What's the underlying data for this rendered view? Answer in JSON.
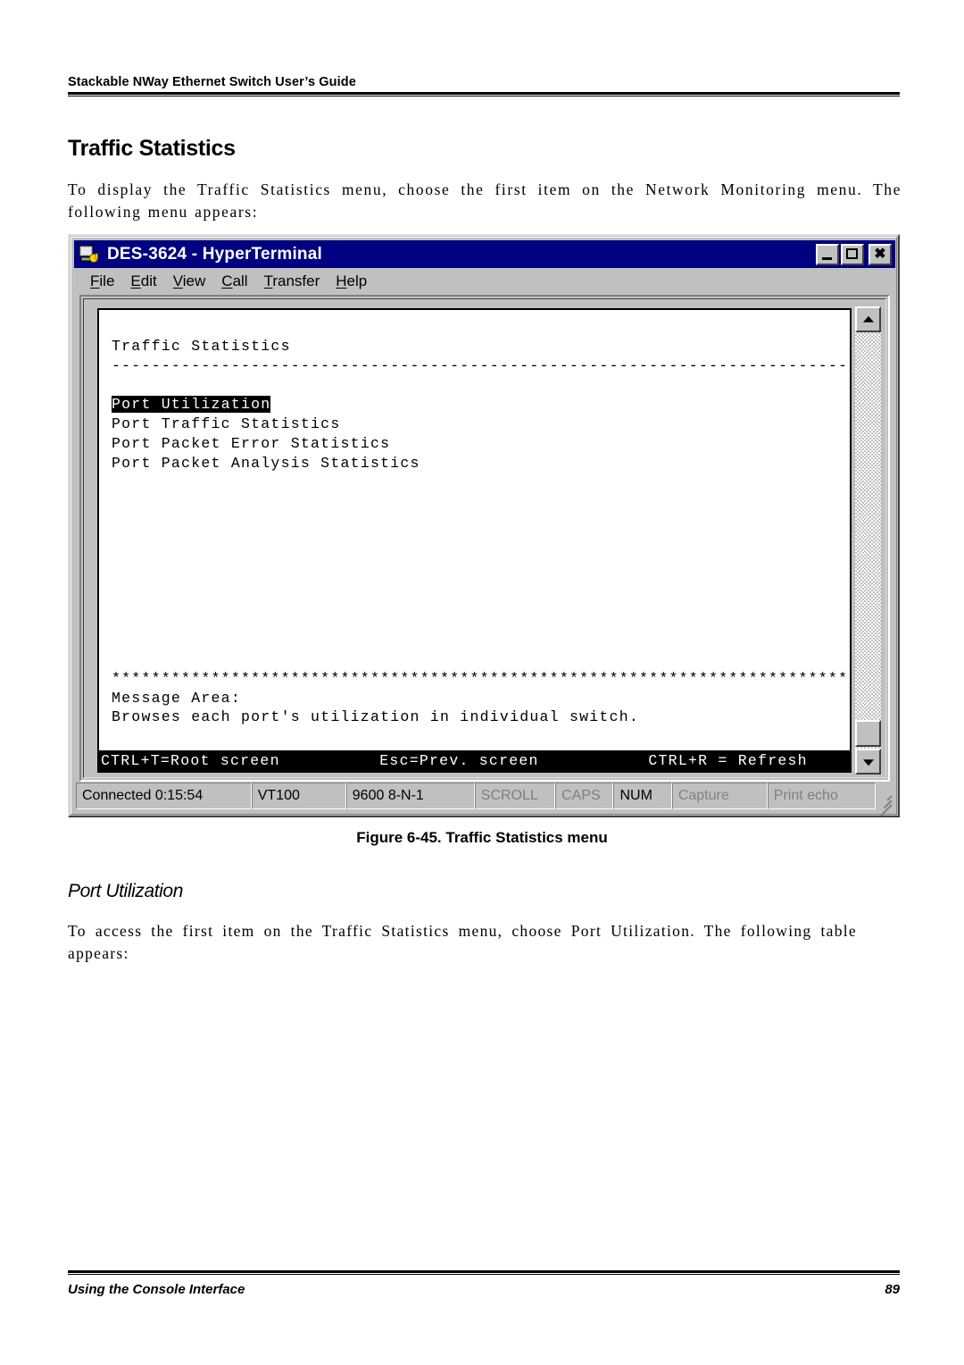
{
  "page": {
    "running_head": "Stackable NWay Ethernet Switch User’s Guide",
    "heading": "Traffic Statistics",
    "intro_paragraph": "To display the Traffic Statistics menu, choose the first item on the Network Monitoring menu. The following menu appears:",
    "figure_caption": "Figure 6-45.  Traffic Statistics menu",
    "subheading": "Port Utilization",
    "access_paragraph": "To access the first item on the Traffic Statistics menu, choose Port Utilization. The following table appears:",
    "footer_left": "Using the Console Interface",
    "footer_page": "89"
  },
  "hyperterminal": {
    "title": "DES-3624 - HyperTerminal",
    "icon": "hyperterminal-icon",
    "window_buttons": {
      "minimize": "–",
      "maximize": "□",
      "close": "✕"
    },
    "menu": [
      {
        "label": "File",
        "accel": "F"
      },
      {
        "label": "Edit",
        "accel": "E"
      },
      {
        "label": "View",
        "accel": "V"
      },
      {
        "label": "Call",
        "accel": "C"
      },
      {
        "label": "Transfer",
        "accel": "T"
      },
      {
        "label": "Help",
        "accel": "H"
      }
    ],
    "statusbar": {
      "connected": "Connected 0:15:54",
      "emulation": "VT100",
      "line_settings": "9600 8-N-1",
      "scroll": "SCROLL",
      "caps": "CAPS",
      "num": "NUM",
      "capture": "Capture",
      "print_echo": "Print echo"
    }
  },
  "terminal": {
    "title": "Traffic Statistics",
    "separator": "----------------------------------------------------------------------------",
    "menu_items": [
      {
        "label": "Port Utilization",
        "selected": true
      },
      {
        "label": "Port Traffic Statistics",
        "selected": false
      },
      {
        "label": "Port Packet Error Statistics",
        "selected": false
      },
      {
        "label": "Port Packet Analysis Statistics",
        "selected": false
      }
    ],
    "asterisk_rule": "****************************************************************************",
    "message_area_label": "Message Area:",
    "message_area_text": "Browses each port's utilization in individual switch.",
    "status_line": {
      "left": "CTRL+T=Root screen",
      "center": "Esc=Prev. screen",
      "right": "CTRL+R = Refresh"
    }
  }
}
